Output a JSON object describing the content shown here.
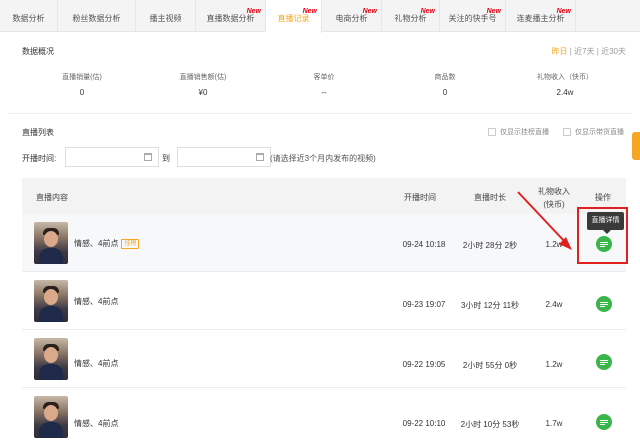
{
  "tabs": [
    {
      "label": "数据分析",
      "new": ""
    },
    {
      "label": "粉丝数据分析",
      "new": ""
    },
    {
      "label": "播主视频",
      "new": ""
    },
    {
      "label": "直播数据分析",
      "new": "New"
    },
    {
      "label": "直播记录",
      "new": "New"
    },
    {
      "label": "电商分析",
      "new": "New"
    },
    {
      "label": "礼物分析",
      "new": "New"
    },
    {
      "label": "关注的快手号",
      "new": "New"
    },
    {
      "label": "连麦播主分析",
      "new": "New"
    }
  ],
  "overview": {
    "title": "数据概况",
    "range": {
      "yesterday": "昨日",
      "sep": "|",
      "last7": "近7天",
      "last30": "近30天"
    },
    "stats": [
      {
        "label": "直播销量(估)",
        "value": "0"
      },
      {
        "label": "直播销售额(估)",
        "value": "¥0"
      },
      {
        "label": "客单价",
        "value": "--"
      },
      {
        "label": "商品数",
        "value": "0"
      },
      {
        "label": "礼物收入（快币）",
        "value": "2.4w"
      }
    ]
  },
  "list": {
    "title": "直播列表",
    "filters": {
      "show_goods": "仅显示挂榜直播",
      "show_sales": "仅显示带货直播",
      "start_label": "开播时间:",
      "to_label": "到",
      "start_value": "",
      "end_value": "",
      "hint": "(请选择近3个月内发布的视频)"
    },
    "columns": {
      "content": "直播内容",
      "start": "开播时间",
      "duration": "直播时长",
      "gift_line1": "礼物收入",
      "gift_line2": "(快币)",
      "action": "操作"
    },
    "rows": [
      {
        "title": "情感、4前点",
        "tag": "挂榜",
        "start": "09-24 10:18",
        "duration": "2小时 28分 2秒",
        "gift": "1.2w"
      },
      {
        "title": "情感、4前点",
        "tag": "",
        "start": "09-23 19:07",
        "duration": "3小时 12分 11秒",
        "gift": "2.4w"
      },
      {
        "title": "情感、4前点",
        "tag": "",
        "start": "09-22 19:05",
        "duration": "2小时 55分 0秒",
        "gift": "1.2w"
      },
      {
        "title": "情感、4前点",
        "tag": "",
        "start": "09-22 10:10",
        "duration": "2小时 10分 53秒",
        "gift": "1.7w"
      }
    ]
  },
  "tooltip": {
    "detail": "直播详情"
  },
  "colors": {
    "accent": "#f5a623",
    "new_badge": "#e60012",
    "op_button": "#3ab54a",
    "annotation": "#e02020"
  }
}
